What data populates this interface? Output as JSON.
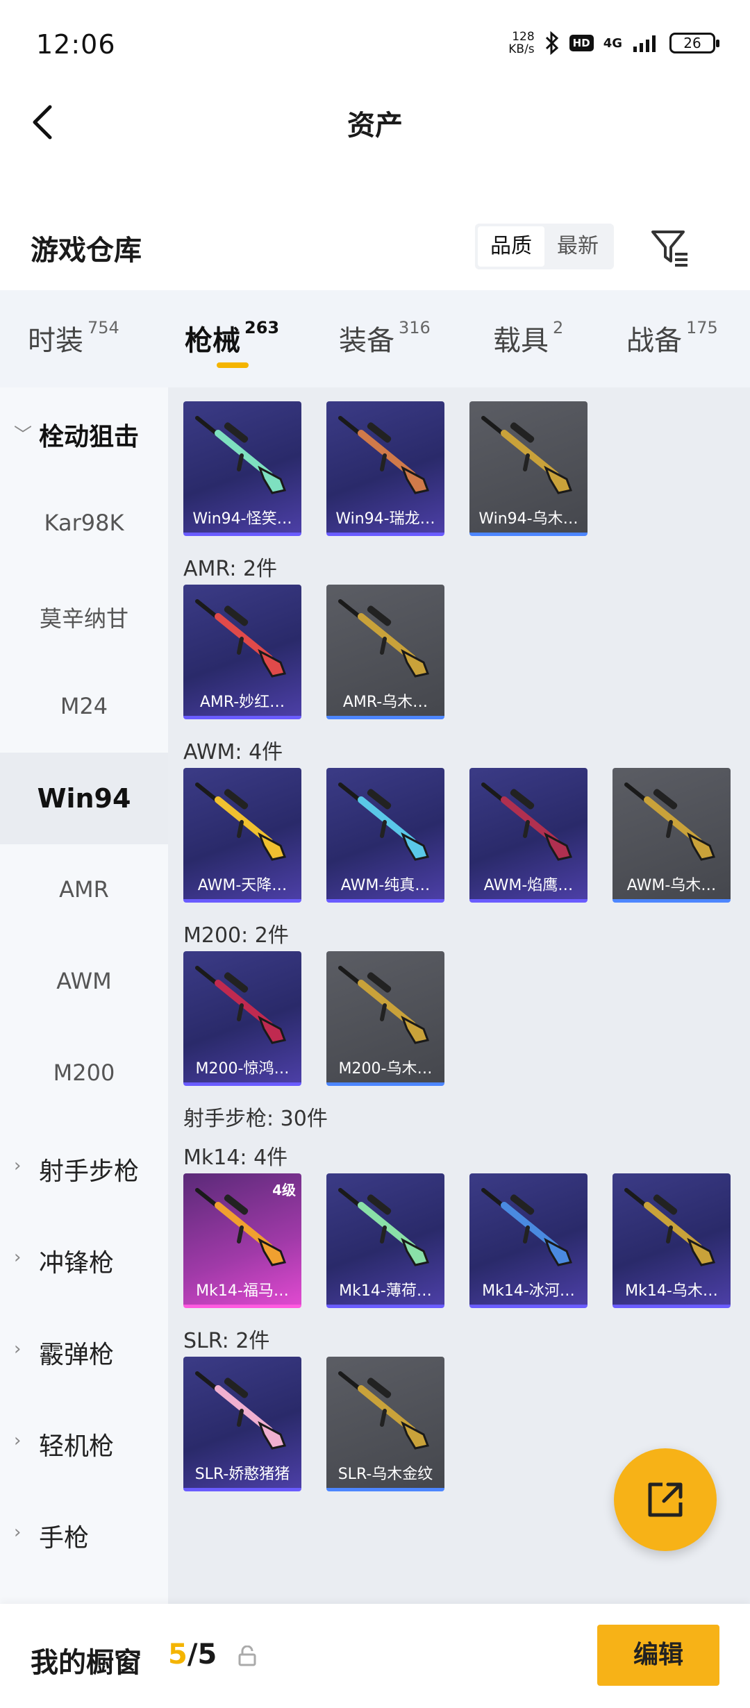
{
  "status_bar": {
    "time": "12:06",
    "net_speed_value": "128",
    "net_speed_unit": "KB/s",
    "hd": "HD",
    "network": "4G",
    "battery": "26"
  },
  "header": {
    "title": "资产"
  },
  "warehouse": {
    "title": "游戏仓库",
    "sort_options": [
      "品质",
      "最新"
    ],
    "sort_selected": "品质"
  },
  "tabs": [
    {
      "label": "时装",
      "count": "754"
    },
    {
      "label": "枪械",
      "count": "263"
    },
    {
      "label": "装备",
      "count": "316"
    },
    {
      "label": "载具",
      "count": "2"
    },
    {
      "label": "战备",
      "count": "175"
    }
  ],
  "sidebar": {
    "groups": [
      {
        "label": "栓动狙击",
        "items": [
          "Kar98K",
          "莫辛纳甘",
          "M24",
          "Win94",
          "AMR",
          "AWM",
          "M200"
        ]
      },
      {
        "label": "射手步枪"
      },
      {
        "label": "冲锋枪"
      },
      {
        "label": "霰弹枪"
      },
      {
        "label": "轻机枪"
      },
      {
        "label": "手枪"
      }
    ],
    "selected": "Win94"
  },
  "sections": [
    {
      "title": "",
      "cards": [
        {
          "name": "Win94-怪笑…",
          "tier": "purple",
          "color": "#7ee0c0"
        },
        {
          "name": "Win94-瑞龙…",
          "tier": "purple",
          "color": "#d07a4a"
        },
        {
          "name": "Win94-乌木…",
          "tier": "gray",
          "color": "#c9a23a"
        }
      ]
    },
    {
      "title": "AMR: 2件",
      "cards": [
        {
          "name": "AMR-妙红…",
          "tier": "purple",
          "color": "#e04a4a"
        },
        {
          "name": "AMR-乌木…",
          "tier": "gray",
          "color": "#c9a23a"
        }
      ]
    },
    {
      "title": "AWM: 4件",
      "cards": [
        {
          "name": "AWM-天降…",
          "tier": "purple",
          "color": "#f0c030"
        },
        {
          "name": "AWM-纯真…",
          "tier": "purple",
          "color": "#5ac8e8"
        },
        {
          "name": "AWM-焰鹰…",
          "tier": "purple",
          "color": "#b03050"
        },
        {
          "name": "AWM-乌木…",
          "tier": "gray",
          "color": "#c9a23a"
        }
      ]
    },
    {
      "title": "M200: 2件",
      "cards": [
        {
          "name": "M200-惊鸿…",
          "tier": "purple",
          "color": "#c02a50"
        },
        {
          "name": "M200-乌木…",
          "tier": "gray",
          "color": "#c9a23a"
        }
      ]
    },
    {
      "title": "射手步枪: 30件",
      "cards": []
    },
    {
      "title": "Mk14: 4件",
      "cards": [
        {
          "name": "Mk14-福马…",
          "tier": "pink",
          "color": "#f0a030",
          "badge": "4级"
        },
        {
          "name": "Mk14-薄荷…",
          "tier": "purple",
          "color": "#8ae0a8"
        },
        {
          "name": "Mk14-冰河…",
          "tier": "purple",
          "color": "#4a8ae0"
        },
        {
          "name": "Mk14-乌木…",
          "tier": "purple",
          "color": "#c9a23a"
        }
      ]
    },
    {
      "title": "SLR: 2件",
      "cards": [
        {
          "name": "SLR-娇憨猪猪",
          "tier": "purple",
          "color": "#f0b0d0"
        },
        {
          "name": "SLR-乌木金纹",
          "tier": "gray",
          "color": "#c9a23a"
        }
      ]
    }
  ],
  "bottom_bar": {
    "showcase_label": "我的橱窗",
    "showcase_current": "5",
    "showcase_total": "/5",
    "edit_label": "编辑"
  },
  "colors": {
    "accent": "#f7b217",
    "tab_underline": "#f4b400",
    "purple_tier": "#6a5cff",
    "gray_tier": "#4d86ff"
  }
}
